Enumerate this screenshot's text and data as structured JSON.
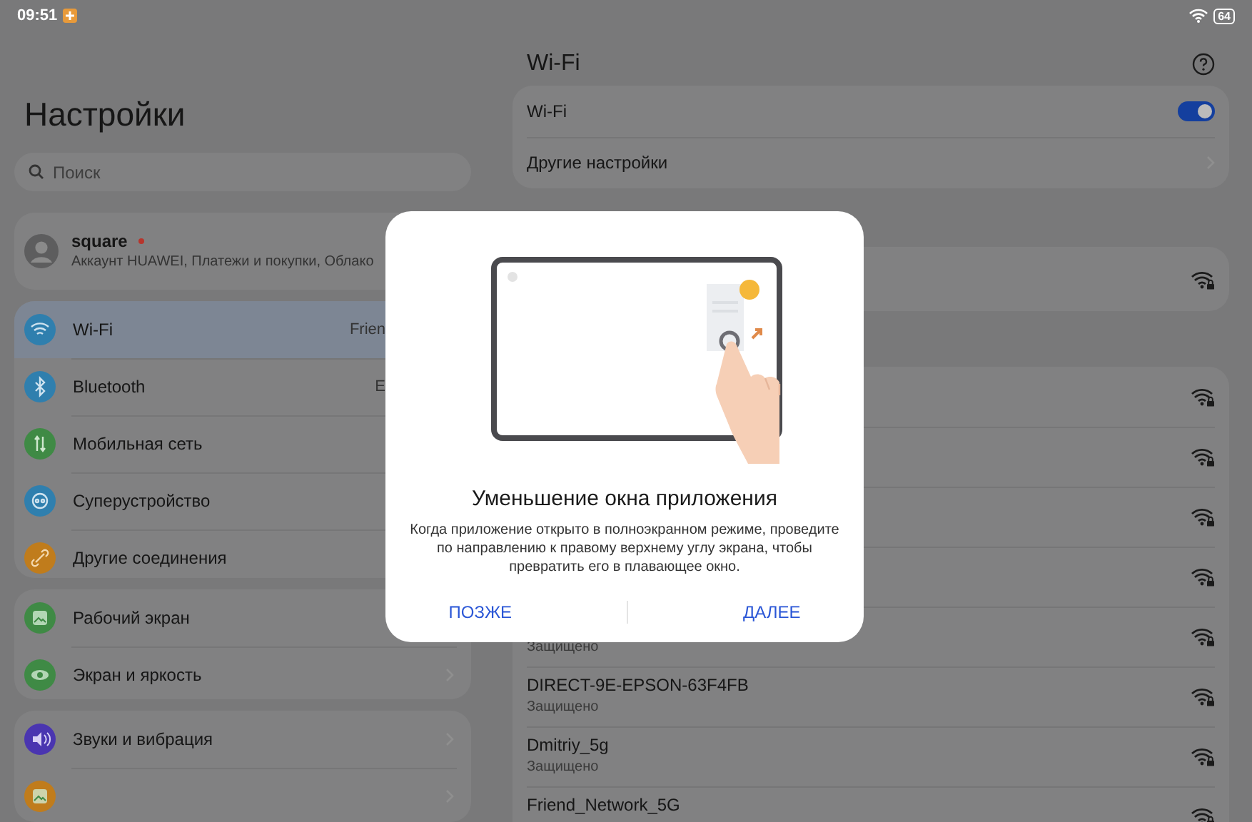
{
  "status_bar": {
    "time": "09:51",
    "battery": "64"
  },
  "sidebar": {
    "title": "Настройки",
    "search": {
      "placeholder": "Поиск"
    },
    "account": {
      "name": "square",
      "subtitle": "Аккаунт HUAWEI, Платежи и покупки, Облако",
      "notification": true
    },
    "groups": [
      {
        "items": [
          {
            "label": "Wi-Fi",
            "value": "Frien",
            "color": "#2f7fae",
            "selected": true
          },
          {
            "label": "Bluetooth",
            "value": "E",
            "color": "#2f7fae",
            "selected": false
          },
          {
            "label": "Мобильная сеть",
            "color": "#3f8a45",
            "selected": false
          },
          {
            "label": "Суперустройство",
            "color": "#2f7fae",
            "selected": false
          },
          {
            "label": "Другие соединения",
            "color": "#c07c1c",
            "selected": false
          }
        ]
      },
      {
        "items": [
          {
            "label": "Рабочий экран",
            "color": "#3f8a45",
            "selected": false
          },
          {
            "label": "Экран и яркость",
            "color": "#3f8a45",
            "selected": false,
            "chevron": true
          }
        ]
      },
      {
        "items": [
          {
            "label": "Звуки и вибрация",
            "color": "#4a35b0",
            "selected": false,
            "chevron": true
          },
          {
            "color": "#c07c1c",
            "selected": false,
            "chevron": true
          }
        ]
      }
    ]
  },
  "wifi_panel": {
    "title": "Wi-Fi",
    "toggle": {
      "label": "Wi-Fi",
      "on": true
    },
    "more": {
      "label": "Другие настройки"
    },
    "connected": [
      {
        "locked": true
      }
    ],
    "networks": [
      {
        "locked": true
      },
      {
        "locked": true
      },
      {
        "locked": true
      },
      {
        "locked": true
      },
      {
        "status": "Защищено",
        "locked": true
      },
      {
        "name": "DIRECT-9E-EPSON-63F4FB",
        "status": "Защищено",
        "locked": true
      },
      {
        "name": "Dmitriy_5g",
        "status": "Защищено",
        "locked": true
      },
      {
        "name": "Friend_Network_5G",
        "locked": true
      }
    ]
  },
  "dialog": {
    "title": "Уменьшение окна приложения",
    "text": "Когда приложение открыто в полноэкранном режиме, проведите по направлению к правому верхнему углу экрана, чтобы превратить его в плавающее окно.",
    "buttons": [
      "ПОЗЖЕ",
      "ДАЛЕЕ"
    ]
  }
}
